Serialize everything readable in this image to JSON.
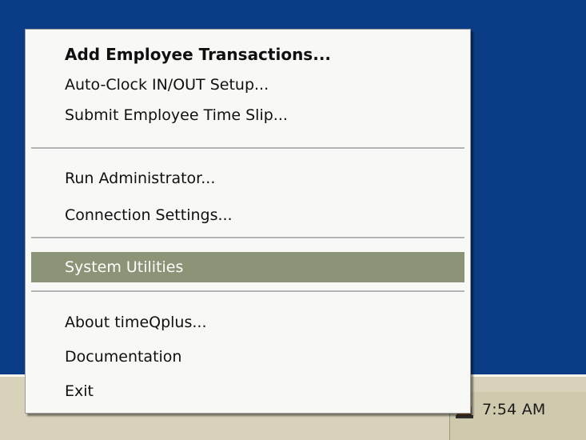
{
  "tray": {
    "clock": "7:54 AM",
    "icon": "timeqplus-tray-icon"
  },
  "menu": {
    "items": [
      {
        "label": "Add Employee Transactions...",
        "bold": true
      },
      {
        "label": "Auto-Clock IN/OUT Setup..."
      },
      {
        "label": "Submit Employee Time Slip..."
      },
      {
        "label": "Run Administrator..."
      },
      {
        "label": "Connection Settings..."
      },
      {
        "label": "System Utilities",
        "highlighted": true
      },
      {
        "label": "About timeQplus..."
      },
      {
        "label": "Documentation"
      },
      {
        "label": "Exit"
      }
    ]
  },
  "colors": {
    "desktop": "#0a3d85",
    "taskbar": "#d8d2ba",
    "menu_highlight": "#8b9476"
  }
}
